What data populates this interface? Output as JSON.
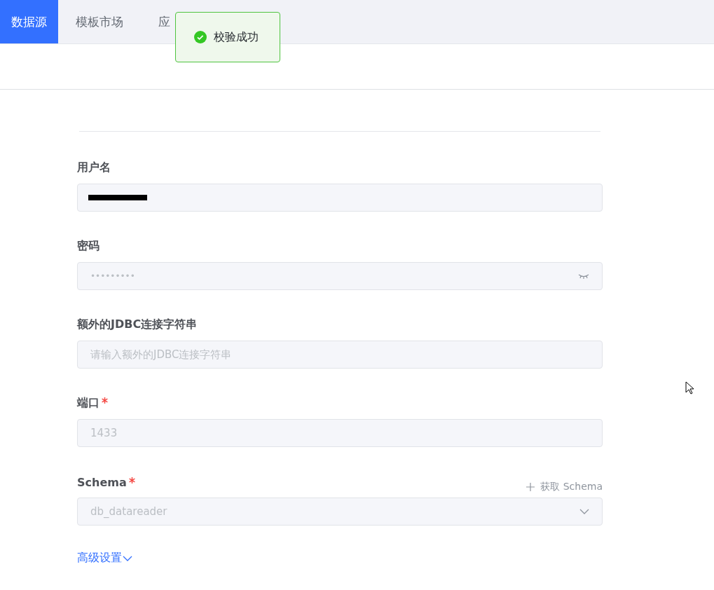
{
  "tabs": [
    {
      "label": "数据源",
      "selected": true
    },
    {
      "label": "模板市场",
      "selected": false
    },
    {
      "label": "应",
      "selected": false
    }
  ],
  "toast": {
    "kind": "success",
    "message": "校验成功"
  },
  "form": {
    "fields": [
      {
        "kind": "text",
        "label": "用户名",
        "required": false,
        "redacted": true
      },
      {
        "kind": "password",
        "label": "密码",
        "required": false,
        "value": "•••••••••"
      },
      {
        "kind": "text",
        "label": "额外的JDBC连接字符串",
        "required": false,
        "placeholder": "请输入额外的JDBC连接字符串"
      },
      {
        "kind": "text",
        "label": "端口",
        "required": true,
        "value": "1433",
        "disabled": true
      },
      {
        "kind": "select",
        "label": "Schema",
        "required": true,
        "value": "db_datareader",
        "disabled": true,
        "action": "获取 Schema"
      }
    ],
    "advanced": "高级设置"
  }
}
